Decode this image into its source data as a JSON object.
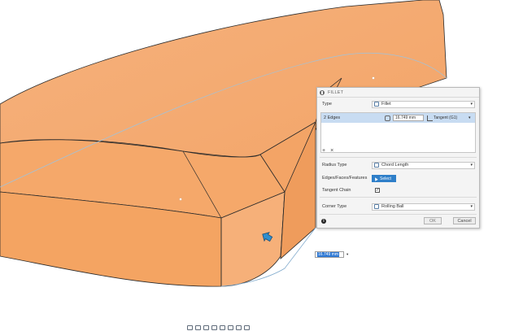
{
  "dialog": {
    "title": "FILLET",
    "type_label": "Type",
    "type_value": "Fillet",
    "selection_edges": "2 Edges",
    "selection_radius": "16.749 mm",
    "selection_continuity": "Tangent (G1)",
    "add_label": "+",
    "remove_label": "×",
    "radius_type_label": "Radius Type",
    "radius_type_value": "Chord Length",
    "edges_label": "Edges/Faces/Features",
    "select_label": "Select",
    "tangent_chain_label": "Tangent Chain",
    "tangent_chain_checked": "✓",
    "corner_type_label": "Corner Type",
    "corner_type_value": "Rolling Ball",
    "info_label": "i",
    "ok_label": "OK",
    "cancel_label": "Cancel"
  },
  "viewport": {
    "radius_input_value": "16.749 mm",
    "body_color": "#f7ad72",
    "annotation_color": "#d9242b"
  },
  "icons": [
    "fillet-icon",
    "chord-length-icon",
    "rolling-ball-icon",
    "tangent-icon",
    "select-cursor-icon",
    "navigation-cursor-icon",
    "info-icon"
  ]
}
